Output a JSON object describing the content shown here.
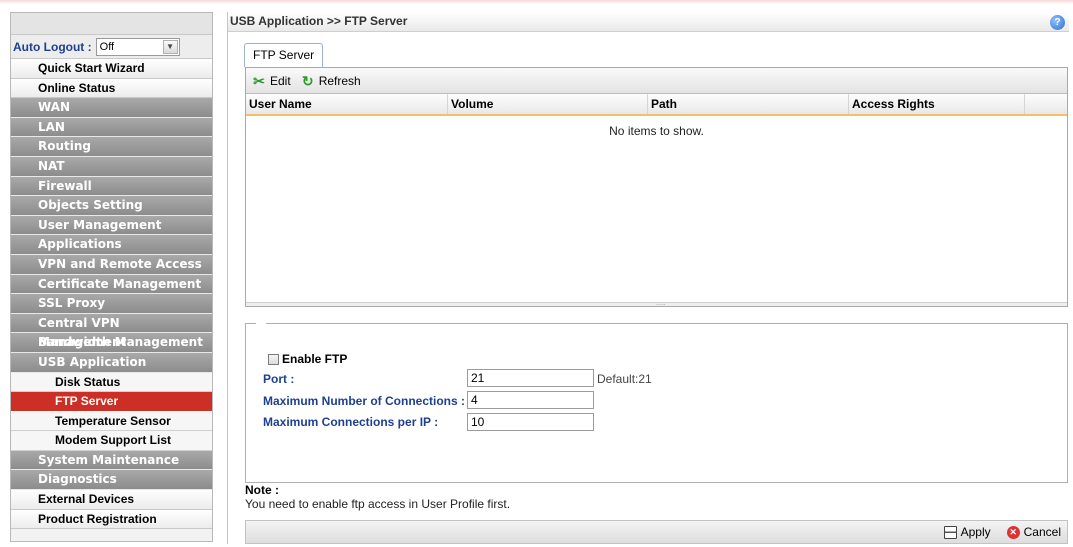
{
  "sidebar": {
    "auto_logout_label": "Auto Logout :",
    "auto_logout_value": "Off",
    "items": [
      {
        "label": "Quick Start Wizard",
        "style": "white"
      },
      {
        "label": "Online Status",
        "style": "white"
      },
      {
        "label": "WAN",
        "style": "gray"
      },
      {
        "label": "LAN",
        "style": "gray"
      },
      {
        "label": "Routing",
        "style": "gray"
      },
      {
        "label": "NAT",
        "style": "gray"
      },
      {
        "label": "Firewall",
        "style": "gray"
      },
      {
        "label": "Objects Setting",
        "style": "gray"
      },
      {
        "label": "User Management",
        "style": "gray"
      },
      {
        "label": "Applications",
        "style": "gray"
      },
      {
        "label": "VPN and Remote Access",
        "style": "gray"
      },
      {
        "label": "Certificate Management",
        "style": "gray"
      },
      {
        "label": "SSL Proxy",
        "style": "gray"
      },
      {
        "label": "Central VPN Management",
        "style": "gray"
      },
      {
        "label": "Bandwidth Management",
        "style": "gray"
      },
      {
        "label": "USB Application",
        "style": "gray"
      },
      {
        "label": "Disk Status",
        "style": "sub"
      },
      {
        "label": "FTP Server",
        "style": "sub-active"
      },
      {
        "label": "Temperature Sensor",
        "style": "sub"
      },
      {
        "label": "Modem Support List",
        "style": "sub"
      },
      {
        "label": "System Maintenance",
        "style": "gray"
      },
      {
        "label": "Diagnostics",
        "style": "gray"
      },
      {
        "label": "External Devices",
        "style": "white"
      },
      {
        "label": "Product Registration",
        "style": "white"
      }
    ]
  },
  "header": {
    "breadcrumb": "USB Application >> FTP Server",
    "help": "?"
  },
  "tab": {
    "label": "FTP Server"
  },
  "toolbar": {
    "edit_label": "Edit",
    "refresh_label": "Refresh"
  },
  "table": {
    "columns": [
      "User Name",
      "Volume",
      "Path",
      "Access Rights"
    ],
    "empty_text": "No items to show."
  },
  "form": {
    "enable_ftp_label": "Enable FTP",
    "enable_ftp_checked": false,
    "port_label": "Port :",
    "port_value": "21",
    "port_hint": "Default:21",
    "max_conn_label": "Maximum Number of Connections :",
    "max_conn_value": "4",
    "max_conn_ip_label": "Maximum Connections per IP :",
    "max_conn_ip_value": "10"
  },
  "note": {
    "title": "Note :",
    "text": "You need to enable ftp access in User Profile first."
  },
  "footer": {
    "apply_label": "Apply",
    "cancel_label": "Cancel"
  }
}
